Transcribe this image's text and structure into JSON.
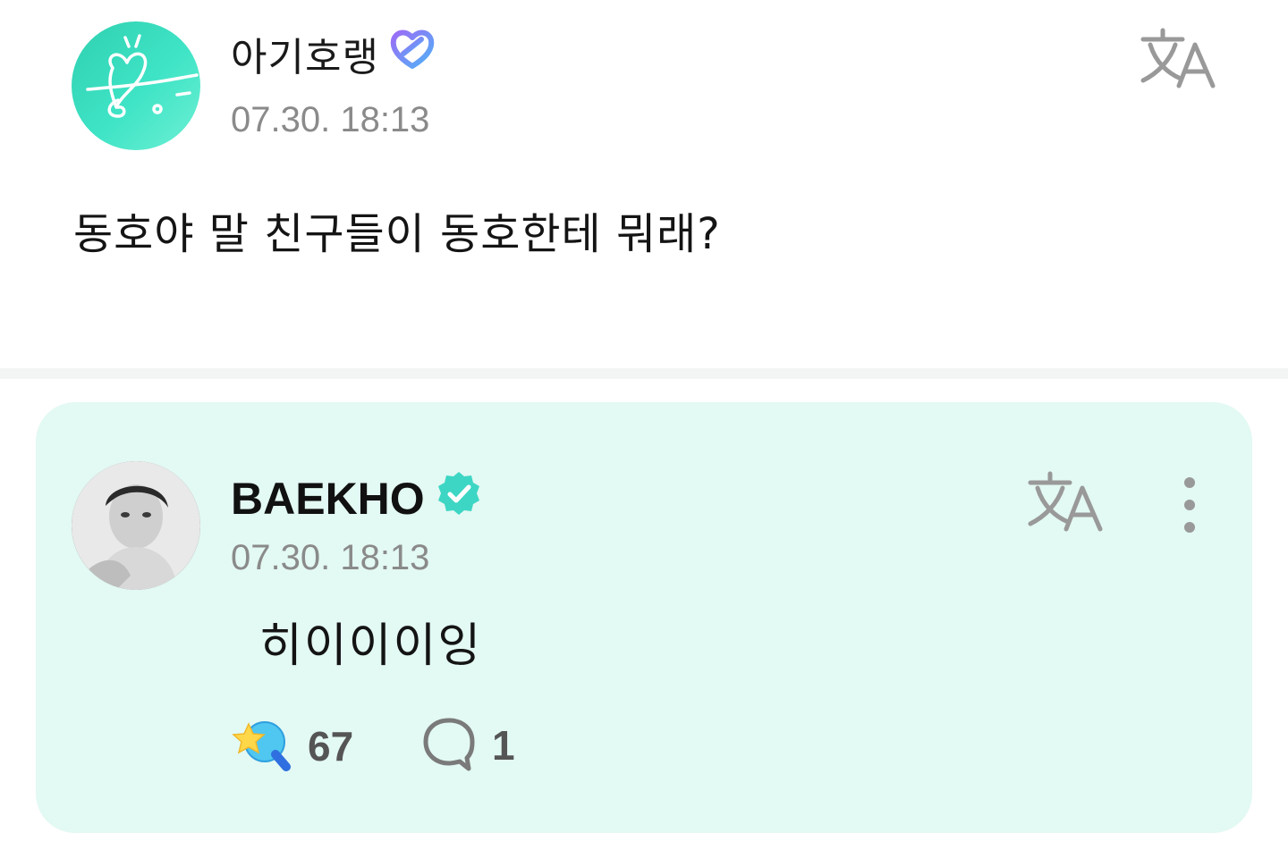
{
  "post": {
    "author": "아기호랭",
    "time": "07.30. 18:13",
    "body": "동호야 말 친구들이 동호한테 뭐래?",
    "badge_icon": "fan-heart-badge-icon",
    "translate_icon": "translate-icon"
  },
  "reply": {
    "author": "BAEKHO",
    "time": "07.30. 18:13",
    "body": "히이이이잉",
    "verified_icon": "verified-badge-icon",
    "translate_icon": "translate-icon",
    "more_icon": "more-vertical-icon",
    "likes": "67",
    "comments": "1"
  },
  "colors": {
    "card_bg": "#e3f9f3",
    "accent_mint": "#3fe4c6",
    "verified": "#3dd6c4",
    "badge_purple": "#7b6cf6",
    "badge_blue": "#55a8f7"
  }
}
